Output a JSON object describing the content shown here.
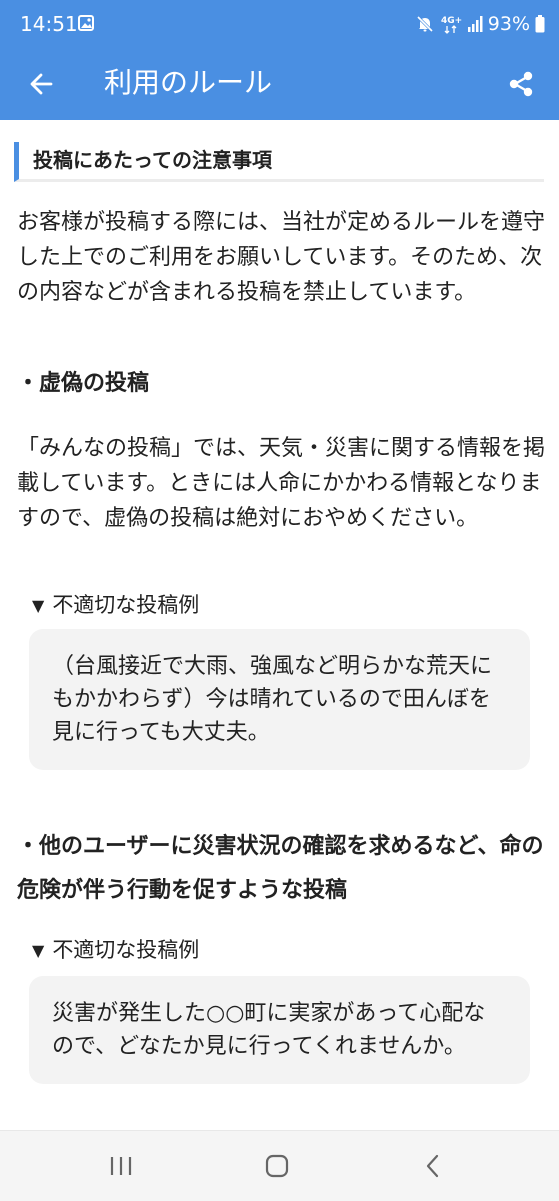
{
  "status_bar": {
    "time": "14:51",
    "network": "4G+",
    "battery": "93%",
    "icons": [
      "gallery-icon",
      "mute-icon",
      "signal-icon",
      "battery-icon"
    ]
  },
  "app_bar": {
    "title": "利用のルール",
    "background_color": "#4a8fe2",
    "icons": [
      "back-arrow-icon",
      "share-icon"
    ]
  },
  "content": {
    "section_title": "投稿にあたっての注意事項",
    "intro": "お客様が投稿する際には、当社が定めるルールを遵守した上でのご利用をお願いしています。そのため、次の内容などが含まれる投稿を禁止しています。",
    "rules": [
      {
        "heading": "・虚偽の投稿",
        "description": "「みんなの投稿」では、天気・災害に関する情報を掲載しています。ときには人命にかかわる情報となりますので、虚偽の投稿は絶対におやめください。",
        "example_label": "不適切な投稿例",
        "example_text": "（台風接近で大雨、強風など明らかな荒天にもかかわらず）今は晴れているので田んぼを見に行っても大丈夫。"
      },
      {
        "heading": "・他のユーザーに災害状況の確認を求めるなど、命の危険が伴う行動を促すような投稿",
        "example_label": "不適切な投稿例",
        "example_text": "災害が発生した○○町に実家があって心配なので、どなたか見に行ってくれませんか。"
      }
    ]
  },
  "nav_bar": {
    "icons": [
      "recent-apps-icon",
      "home-icon",
      "back-icon"
    ]
  }
}
